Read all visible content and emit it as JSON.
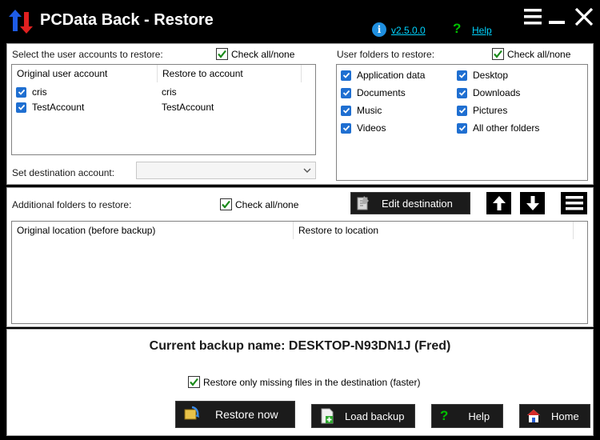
{
  "window": {
    "title": "PCData Back - Restore",
    "version": "v2.5.0.0",
    "help_link": "Help"
  },
  "accounts": {
    "section_label": "Select the user accounts to restore:",
    "check_all": "Check all/none",
    "columns": [
      "Original user account",
      "Restore to account"
    ],
    "rows": [
      {
        "original": "cris",
        "restore_to": "cris"
      },
      {
        "original": "TestAccount",
        "restore_to": "TestAccount"
      }
    ],
    "destination_label": "Set destination account:",
    "destination_value": ""
  },
  "user_folders": {
    "section_label": "User folders to restore:",
    "check_all": "Check all/none",
    "left": [
      "Application data",
      "Documents",
      "Music",
      "Videos"
    ],
    "right": [
      "Desktop",
      "Downloads",
      "Pictures",
      "All other folders"
    ]
  },
  "additional": {
    "section_label": "Additional folders to restore:",
    "check_all": "Check all/none",
    "edit_destination": "Edit destination",
    "columns": [
      "Original location (before backup)",
      "Restore to location"
    ]
  },
  "bottom": {
    "backup_name": "Current backup name: DESKTOP-N93DN1J (Fred)",
    "restore_missing": "Restore only missing files in the destination (faster)",
    "restore_now": "Restore now",
    "load_backup": "Load backup",
    "help": "Help",
    "home": "Home"
  },
  "colors": {
    "accent_blue": "#1f6fd1",
    "link_cyan": "#00d3ff",
    "help_green": "#00c000"
  }
}
